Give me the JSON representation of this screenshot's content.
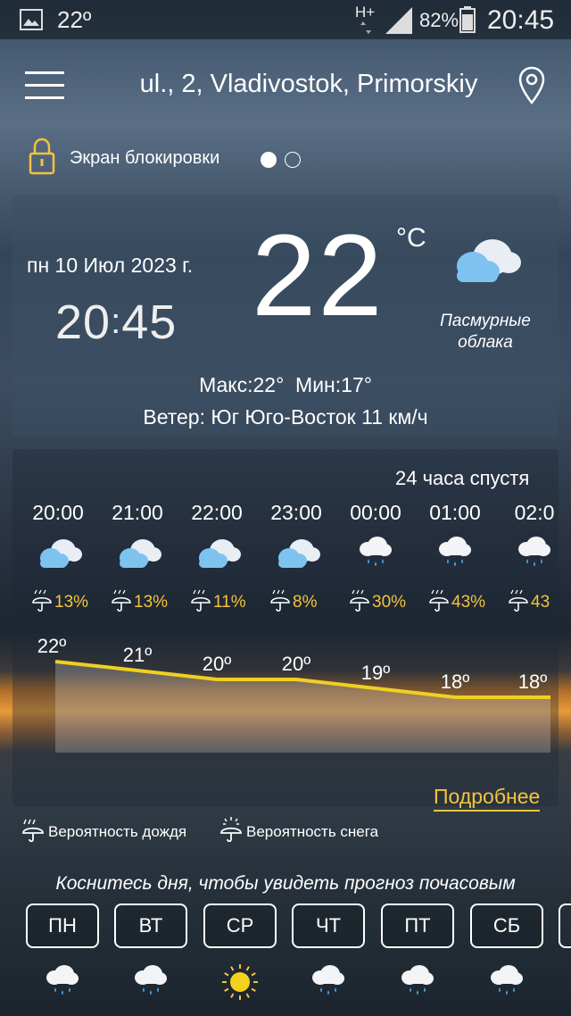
{
  "status_bar": {
    "temp": "22º",
    "network": "H+",
    "battery": "82%",
    "time": "20:45"
  },
  "header": {
    "location": "ul., 2, Vladivostok, Primorskiy"
  },
  "lock": {
    "label": "Экран блокировки"
  },
  "current": {
    "date": "пн 10 Июл 2023 г.",
    "time_hh": "20",
    "time_mm": "45",
    "temperature": "22",
    "unit": "°C",
    "condition_line1": "Пасмурные",
    "condition_line2": "облака",
    "max_label": "Макс:",
    "max_value": "22°",
    "min_label": "Мин:",
    "min_value": "17°",
    "wind_label": "Ветер:",
    "wind_value": "Юг Юго-Восток 11 км/ч"
  },
  "hourly": {
    "title": "24 часа спустя",
    "items": [
      {
        "time": "20:00",
        "icon": "cloud-icon",
        "precip": "13%",
        "temp": "22º"
      },
      {
        "time": "21:00",
        "icon": "cloud-icon",
        "precip": "13%",
        "temp": "21º"
      },
      {
        "time": "22:00",
        "icon": "cloud-icon",
        "precip": "11%",
        "temp": "20º"
      },
      {
        "time": "23:00",
        "icon": "cloud-icon",
        "precip": "8%",
        "temp": "20º"
      },
      {
        "time": "00:00",
        "icon": "rain-cloud-icon",
        "precip": "30%",
        "temp": "19º"
      },
      {
        "time": "01:00",
        "icon": "rain-cloud-icon",
        "precip": "43%",
        "temp": "18º"
      },
      {
        "time": "02:0",
        "icon": "rain-cloud-icon",
        "precip": "43",
        "temp": "18º"
      }
    ],
    "temps": [
      22,
      21,
      20,
      20,
      19,
      18,
      18
    ],
    "more_link": "Подробнее"
  },
  "legend": {
    "rain": "Вероятность дождя",
    "snow": "Вероятность снега"
  },
  "daily": {
    "hint": "Коснитесь дня, чтобы увидеть прогноз почасовым",
    "days": [
      {
        "label": "ПН",
        "icon": "rain-cloud-icon"
      },
      {
        "label": "ВТ",
        "icon": "rain-cloud-icon"
      },
      {
        "label": "СР",
        "icon": "sun-icon"
      },
      {
        "label": "ЧТ",
        "icon": "rain-cloud-icon"
      },
      {
        "label": "ПТ",
        "icon": "rain-cloud-icon"
      },
      {
        "label": "СБ",
        "icon": "rain-cloud-icon"
      }
    ]
  },
  "colors": {
    "accent": "#f5c33b",
    "line": "#f0d020"
  }
}
